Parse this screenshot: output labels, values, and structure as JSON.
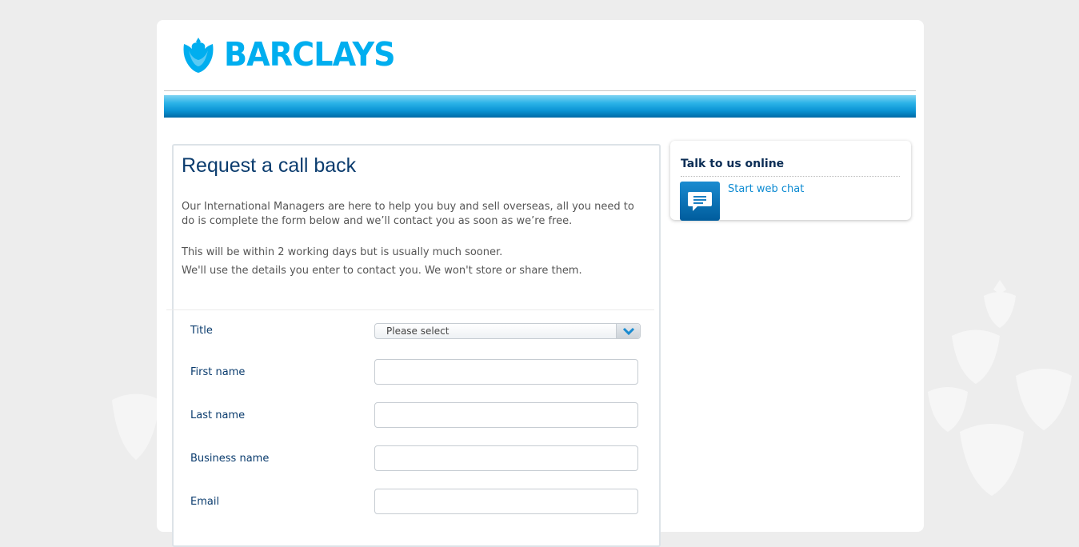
{
  "brand": {
    "name": "BARCLAYS",
    "color": "#00aeef",
    "logo_icon": "eagle-icon"
  },
  "main": {
    "title": "Request a call back",
    "intro_paragraph": "Our International Managers are here to help you buy and sell overseas, all you need to do is complete the form below and we’ll contact you as soon as we’re free.",
    "timing_note": "This will be within 2 working days but is usually much sooner.",
    "privacy_note": "We'll use the details you enter to contact you. We won't store or share them."
  },
  "form": {
    "title_label": "Title",
    "title_select_value": "Please select",
    "first_name_label": "First name",
    "first_name_value": "",
    "last_name_label": "Last name",
    "last_name_value": "",
    "business_name_label": "Business name",
    "business_name_value": "",
    "email_label": "Email",
    "email_value": ""
  },
  "sidebar": {
    "heading": "Talk to us online",
    "chat_link": "Start web chat",
    "chat_icon": "chat-bubble-icon"
  },
  "colors": {
    "heading_navy": "#0b3c6e",
    "link_blue": "#0d8bd2",
    "band_blue": "#0a93d3"
  }
}
